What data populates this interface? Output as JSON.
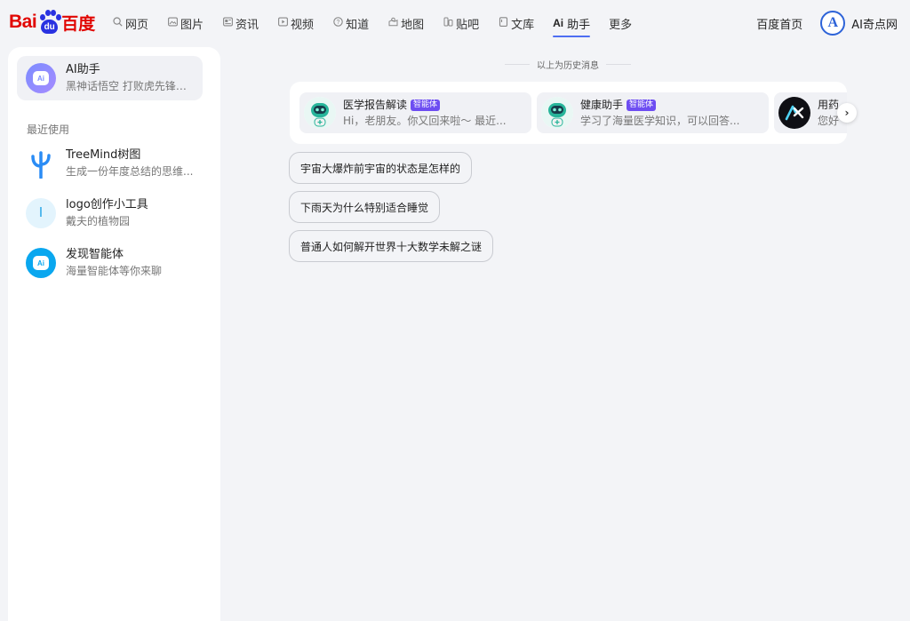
{
  "brand": {
    "logo_left": "Bai",
    "logo_paw": "du",
    "logo_right": "百度"
  },
  "nav": {
    "items": [
      {
        "label": "网页",
        "icon": "search-icon"
      },
      {
        "label": "图片",
        "icon": "image-icon"
      },
      {
        "label": "资讯",
        "icon": "news-icon"
      },
      {
        "label": "视频",
        "icon": "video-icon"
      },
      {
        "label": "知道",
        "icon": "question-icon"
      },
      {
        "label": "地图",
        "icon": "map-icon"
      },
      {
        "label": "贴吧",
        "icon": "tieba-icon"
      },
      {
        "label": "文库",
        "icon": "document-icon"
      },
      {
        "label": "助手",
        "icon": "ai-icon",
        "icon_text": "Ai",
        "active": true
      },
      {
        "label": "更多",
        "icon": ""
      }
    ],
    "home_link": "百度首页",
    "site_avatar_letter": "A",
    "site_name": "AI奇点网"
  },
  "sidebar": {
    "active_item": {
      "title": "AI助手",
      "subtitle": "黑神话悟空 打败虎先锋的..."
    },
    "recent_label": "最近使用",
    "recent_items": [
      {
        "title": "TreeMind树图",
        "subtitle": "生成一份年度总结的思维..."
      },
      {
        "title": "logo创作小工具",
        "subtitle": "戴夫的植物园",
        "icon_letter": "I"
      },
      {
        "title": "发现智能体",
        "subtitle": "海量智能体等你来聊"
      }
    ]
  },
  "main": {
    "history_label": "以上为历史消息",
    "agents": [
      {
        "name": "医学报告解读",
        "badge": "智能体",
        "desc": "Hi，老朋友。你又回来啦～ 最近..."
      },
      {
        "name": "健康助手",
        "badge": "智能体",
        "desc": "学习了海量医学知识，可以回答..."
      },
      {
        "name": "用药",
        "badge": "",
        "desc": "您好"
      }
    ],
    "suggestions": [
      "宇宙大爆炸前宇宙的状态是怎样的",
      "下雨天为什么特别适合睡觉",
      "普通人如何解开世界十大数学未解之谜"
    ],
    "next_arrow": "›"
  },
  "colors": {
    "accent": "#4e6ef2",
    "brand_red": "#e10602",
    "brand_blue": "#2932e1",
    "badge": "#6d4df2"
  }
}
